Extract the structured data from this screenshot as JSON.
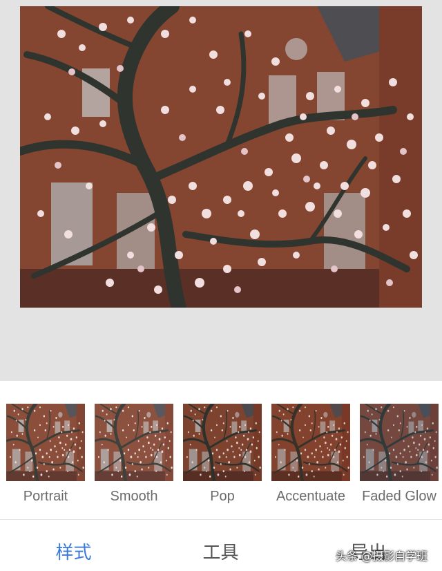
{
  "filters": [
    {
      "label": "Portrait"
    },
    {
      "label": "Smooth"
    },
    {
      "label": "Pop"
    },
    {
      "label": "Accentuate"
    },
    {
      "label": "Faded Glow"
    }
  ],
  "bottom_nav": {
    "tabs": [
      {
        "label": "样式",
        "active": true
      },
      {
        "label": "工具",
        "active": false
      },
      {
        "label": "导出",
        "active": false
      }
    ]
  },
  "watermark": "头条 @摄影自学班",
  "colors": {
    "accent": "#3b78d8",
    "canvas_bg": "#e3e3e3",
    "label_gray": "#6b6b6b",
    "brick": "#8a4a32"
  }
}
